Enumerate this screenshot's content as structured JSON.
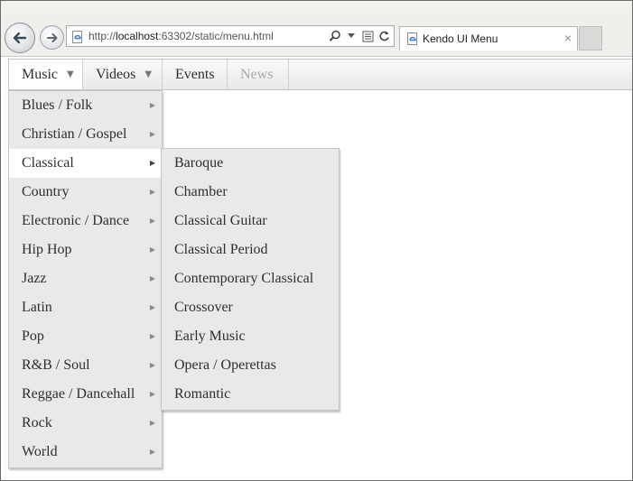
{
  "browser": {
    "url_prefix": "http://",
    "url_host": "localhost",
    "url_rest": ":63302/static/menu.html",
    "tab_title": "Kendo UI Menu",
    "tab_close": "×",
    "icons": [
      "back-arrow-icon",
      "forward-arrow-icon",
      "ie-page-icon",
      "search-icon",
      "dropdown-icon",
      "compat-view-icon",
      "refresh-icon"
    ]
  },
  "menu": {
    "items": [
      {
        "label": "Music",
        "has_children": true,
        "state": "open"
      },
      {
        "label": "Videos",
        "has_children": true,
        "state": "normal"
      },
      {
        "label": "Events",
        "has_children": false,
        "state": "normal"
      },
      {
        "label": "News",
        "has_children": false,
        "state": "disabled"
      }
    ],
    "caret": "▼"
  },
  "music_submenu": {
    "arrow": "▶",
    "highlighted": "Classical",
    "items": [
      "Blues / Folk",
      "Christian / Gospel",
      "Classical",
      "Country",
      "Electronic / Dance",
      "Hip Hop",
      "Jazz",
      "Latin",
      "Pop",
      "R&B / Soul",
      "Reggae / Dancehall",
      "Rock",
      "World"
    ]
  },
  "classical_submenu": {
    "items": [
      "Baroque",
      "Chamber",
      "Classical Guitar",
      "Classical Period",
      "Contemporary Classical",
      "Crossover",
      "Early Music",
      "Opera / Operettas",
      "Romantic"
    ]
  },
  "colors": {
    "menu_bg": "#e9e9e9",
    "highlight_bg": "#ffffff",
    "disabled_text": "#a9a9a9",
    "text": "#2e2e2e"
  }
}
